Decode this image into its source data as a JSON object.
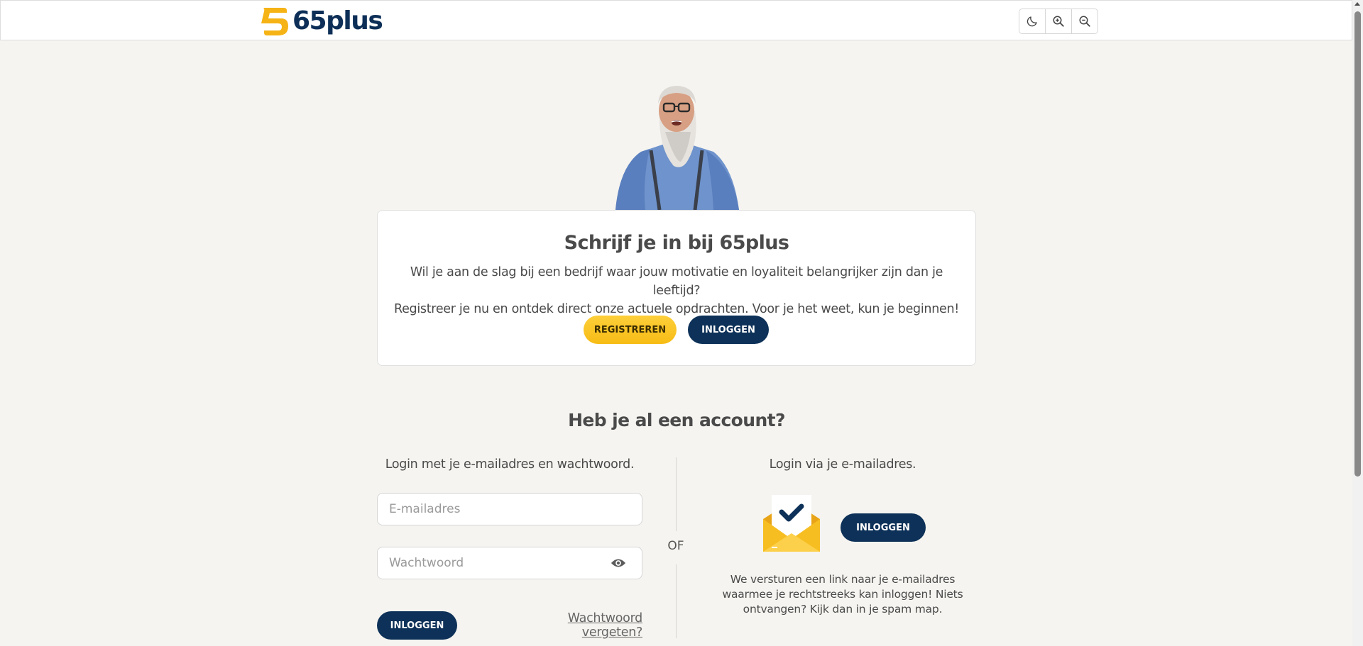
{
  "header": {
    "logo_text": "65plus",
    "tools": [
      {
        "name": "dark-mode",
        "icon": "moon-icon"
      },
      {
        "name": "zoom-in",
        "icon": "zoom-in-icon"
      },
      {
        "name": "zoom-out",
        "icon": "zoom-out-icon"
      }
    ]
  },
  "signup": {
    "title": "Schrijf je in bij 65plus",
    "text_line1": "Wil je aan de slag bij een bedrijf waar jouw motivatie en loyaliteit belangrijker zijn dan je leeftijd?",
    "text_line2": "Registreer je nu en ontdek direct onze actuele opdrachten. Voor je het weet, kun je beginnen!",
    "register_label": "REGISTREREN",
    "login_label": "INLOGGEN"
  },
  "login": {
    "title": "Heb je al een account?",
    "password_col_label": "Login met je e-mailadres en wachtwoord.",
    "email_placeholder": "E-mailadres",
    "password_placeholder": "Wachtwoord",
    "login_label": "INLOGGEN",
    "forgot_label": "Wachtwoord vergeten?",
    "or_label": "OF",
    "magic_col_label": "Login via je e-mailadres.",
    "magic_login_label": "INLOGGEN",
    "magic_text": "We versturen een link naar je e-mailadres waarmee je rechtstreeks kan inloggen! Niets ontvangen? Kijk dan in je spam map."
  },
  "colors": {
    "background": "#f5f4f0",
    "navy": "#0d3158",
    "yellow": "#f7bc15"
  }
}
